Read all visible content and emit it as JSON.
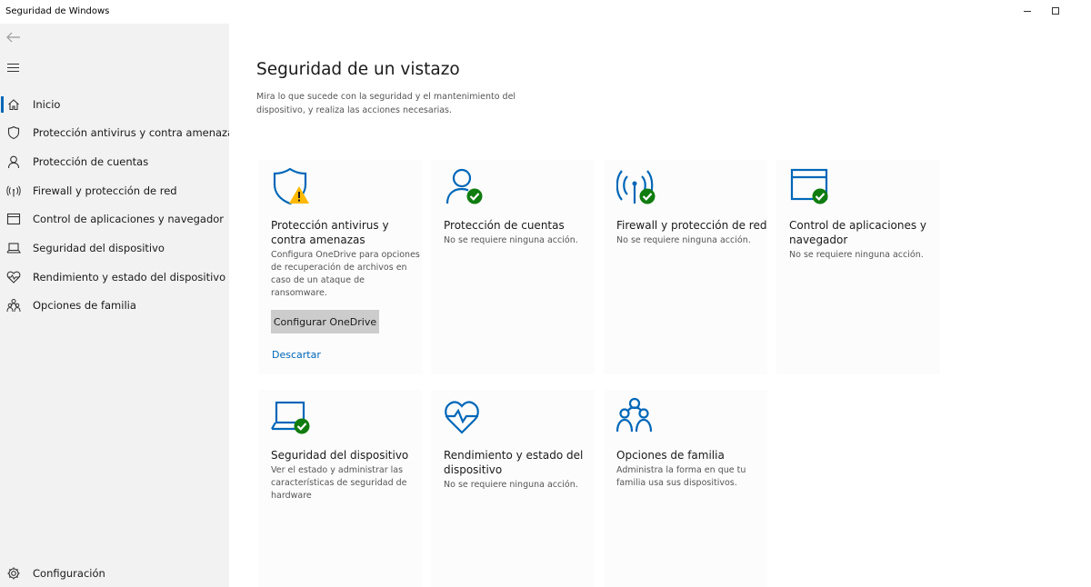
{
  "window": {
    "title": "Seguridad de Windows"
  },
  "sidebar": {
    "items": [
      {
        "label": "Inicio",
        "icon": "home-icon"
      },
      {
        "label": "Protección antivirus y contra amenazas",
        "icon": "shield-icon"
      },
      {
        "label": "Protección de cuentas",
        "icon": "person-icon"
      },
      {
        "label": "Firewall y protección de red",
        "icon": "wifi-antenna-icon"
      },
      {
        "label": "Control de aplicaciones y navegador",
        "icon": "browser-window-icon"
      },
      {
        "label": "Seguridad del dispositivo",
        "icon": "laptop-icon"
      },
      {
        "label": "Rendimiento y estado del dispositivo",
        "icon": "heart-pulse-icon"
      },
      {
        "label": "Opciones de familia",
        "icon": "family-icon"
      }
    ],
    "settings_label": "Configuración",
    "active_index": 0
  },
  "main": {
    "title": "Seguridad de un vistazo",
    "description": "Mira lo que sucede con la seguridad y el mantenimiento del dispositivo, y realiza las acciones necesarias.",
    "cards": [
      {
        "title": "Protección antivirus y contra amenazas",
        "description": "Configura OneDrive para opciones de recuperación de archivos en caso de un ataque de ransomware.",
        "button": "Configurar OneDrive",
        "link": "Descartar",
        "status": "warning"
      },
      {
        "title": "Protección de cuentas",
        "description": "No se requiere ninguna acción.",
        "status": "ok"
      },
      {
        "title": "Firewall y protección de red",
        "description": "No se requiere ninguna acción.",
        "status": "ok"
      },
      {
        "title": "Control de aplicaciones y navegador",
        "description": "No se requiere ninguna acción.",
        "status": "ok"
      },
      {
        "title": "Seguridad del dispositivo",
        "description": "Ver el estado y administrar las características de seguridad de hardware",
        "status": "ok"
      },
      {
        "title": "Rendimiento y estado del dispositivo",
        "description": "No se requiere ninguna acción.",
        "status": "ok"
      },
      {
        "title": "Opciones de familia",
        "description": "Administra la forma en que tu familia usa sus dispositivos.",
        "status": "none"
      }
    ]
  },
  "colors": {
    "accent": "#0067b8",
    "ok": "#107c10",
    "warning": "#ffb900",
    "sidebar_bg": "#f2f2f2",
    "button_bg": "#cccccc"
  }
}
